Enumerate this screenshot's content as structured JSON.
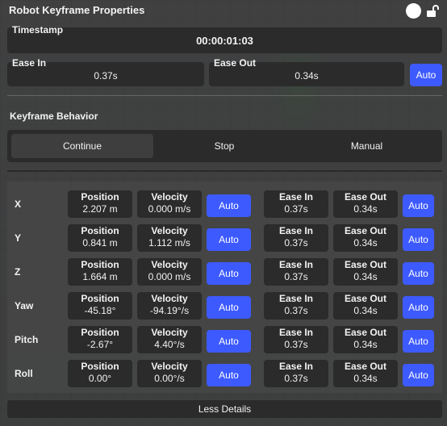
{
  "window": {
    "title": "Robot Keyframe Properties"
  },
  "header_icons": [
    "circle-icon",
    "unlock-icon"
  ],
  "timestamp": {
    "label": "Timestamp",
    "value": "00:00:01:03"
  },
  "ease": {
    "in_label": "Ease In",
    "in_value": "0.37s",
    "out_label": "Ease Out",
    "out_value": "0.34s",
    "auto_label": "Auto"
  },
  "behavior": {
    "title": "Keyframe Behavior",
    "options": [
      "Continue",
      "Stop",
      "Manual"
    ],
    "selected": "Continue"
  },
  "axes": [
    {
      "name": "X",
      "position_label": "Position",
      "position": "2.207 m",
      "velocity_label": "Velocity",
      "velocity": "0.000 m/s",
      "auto": "Auto",
      "ease_in_label": "Ease In",
      "ease_in": "0.37s",
      "ease_out_label": "Ease Out",
      "ease_out": "0.34s",
      "auto2": "Auto"
    },
    {
      "name": "Y",
      "position_label": "Position",
      "position": "0.841 m",
      "velocity_label": "Velocity",
      "velocity": "1.112 m/s",
      "auto": "Auto",
      "ease_in_label": "Ease In",
      "ease_in": "0.37s",
      "ease_out_label": "Ease Out",
      "ease_out": "0.34s",
      "auto2": "Auto"
    },
    {
      "name": "Z",
      "position_label": "Position",
      "position": "1.664 m",
      "velocity_label": "Velocity",
      "velocity": "0.000 m/s",
      "auto": "Auto",
      "ease_in_label": "Ease In",
      "ease_in": "0.37s",
      "ease_out_label": "Ease Out",
      "ease_out": "0.34s",
      "auto2": "Auto"
    },
    {
      "name": "Yaw",
      "position_label": "Position",
      "position": "-45.18°",
      "velocity_label": "Velocity",
      "velocity": "-94.19°/s",
      "auto": "Auto",
      "ease_in_label": "Ease In",
      "ease_in": "0.37s",
      "ease_out_label": "Ease Out",
      "ease_out": "0.34s",
      "auto2": "Auto"
    },
    {
      "name": "Pitch",
      "position_label": "Position",
      "position": "-2.67°",
      "velocity_label": "Velocity",
      "velocity": "4.40°/s",
      "auto": "Auto",
      "ease_in_label": "Ease In",
      "ease_in": "0.37s",
      "ease_out_label": "Ease Out",
      "ease_out": "0.34s",
      "auto2": "Auto"
    },
    {
      "name": "Roll",
      "position_label": "Position",
      "position": "0.00°",
      "velocity_label": "Velocity",
      "velocity": "0.00°/s",
      "auto": "Auto",
      "ease_in_label": "Ease In",
      "ease_in": "0.37s",
      "ease_out_label": "Ease Out",
      "ease_out": "0.34s",
      "auto2": "Auto"
    }
  ],
  "footer": {
    "less_details": "Less Details"
  },
  "colors": {
    "accent": "#3d5afe",
    "field_bg": "#2b2b2b",
    "panel_bg": "#3a3a3a"
  }
}
